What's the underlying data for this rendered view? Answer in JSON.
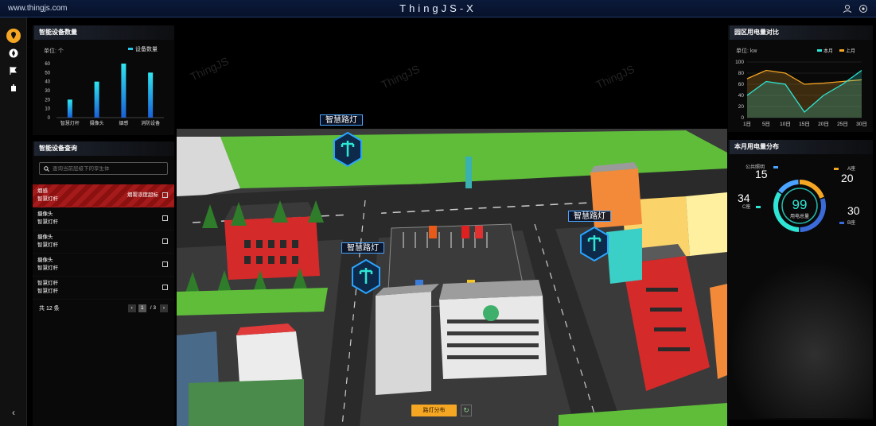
{
  "topbar": {
    "url": "www.thingjs.com",
    "title": "ThingJS-X"
  },
  "left_rail": {
    "items": [
      "location-icon",
      "compass-icon",
      "flag-icon",
      "robot-icon"
    ],
    "collapse": "‹"
  },
  "device_count": {
    "title": "智能设备数量",
    "unit": "单位: 个",
    "legend": "设备数量",
    "chart_data": {
      "type": "bar",
      "categories": [
        "智慧灯杆",
        "摄像头",
        "烟感",
        "消防设备"
      ],
      "values": [
        20,
        40,
        60,
        50
      ],
      "ylim": [
        0,
        60
      ],
      "yticks": [
        0,
        10,
        20,
        30,
        40,
        50,
        60
      ],
      "ylabel": "单位: 个",
      "series": [
        {
          "name": "设备数量",
          "values": [
            20,
            40,
            60,
            50
          ]
        }
      ]
    }
  },
  "device_query": {
    "title": "智能设备查询",
    "search_placeholder": "查询当前层级下的孪生体",
    "rows": [
      {
        "line1": "烟感",
        "line2": "智慧灯杆",
        "msg": "烟雾浓度超标",
        "alert": true
      },
      {
        "line1": "摄像头",
        "line2": "智慧灯杆",
        "msg": "",
        "alert": false
      },
      {
        "line1": "摄像头",
        "line2": "智慧灯杆",
        "msg": "",
        "alert": false
      },
      {
        "line1": "摄像头",
        "line2": "智慧灯杆",
        "msg": "",
        "alert": false
      },
      {
        "line1": "智慧灯杆",
        "line2": "智慧灯杆",
        "msg": "",
        "alert": false
      }
    ],
    "total": "共 12 条",
    "page": "1",
    "page_total": "/ 3"
  },
  "power_compare": {
    "title": "园区用电量对比",
    "unit": "单位: kw",
    "chart_data": {
      "type": "line",
      "x": [
        "1日",
        "5日",
        "10日",
        "15日",
        "20日",
        "25日",
        "30日"
      ],
      "ylim": [
        0,
        100
      ],
      "yticks": [
        0,
        20,
        40,
        60,
        80,
        100
      ],
      "series": [
        {
          "name": "本月",
          "color": "#2ee6d6",
          "values": [
            40,
            65,
            60,
            10,
            40,
            60,
            85
          ]
        },
        {
          "name": "上月",
          "color": "#f5a623",
          "values": [
            70,
            85,
            80,
            60,
            62,
            65,
            68
          ]
        }
      ],
      "legend_position": "top-right"
    }
  },
  "power_dist": {
    "title": "本月用电量分布",
    "center_value": "99",
    "center_label": "用电总量",
    "segments": [
      {
        "name": "公共照明",
        "value": "15",
        "color": "#4aa3ff"
      },
      {
        "name": "A座",
        "value": "20",
        "color": "#f5a623"
      },
      {
        "name": "C座",
        "value": "34",
        "color": "#2ee6d6"
      },
      {
        "name": "B座",
        "value": "30",
        "color": "#3a6bd8"
      }
    ]
  },
  "scene": {
    "tags": [
      "智慧路灯",
      "智慧路灯",
      "智慧路灯"
    ],
    "watermarks": [
      "ThingJS",
      "ThingJS",
      "ThingJS"
    ],
    "bottom_button": "路灯分布",
    "refresh": "↻"
  }
}
